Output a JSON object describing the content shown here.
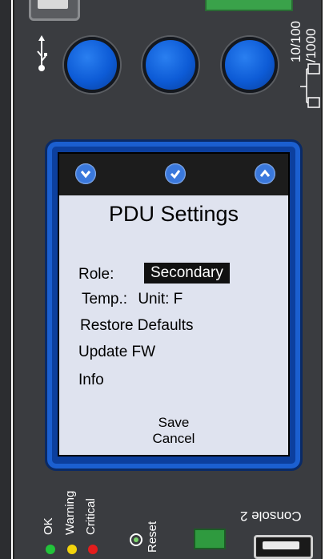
{
  "network": {
    "speed_line1": "10/100",
    "speed_line2": "/1000"
  },
  "screen": {
    "title": "PDU Settings",
    "role_label": "Role:",
    "role_value": "Secondary",
    "temp_label": "Temp.:",
    "temp_value": "Unit: F",
    "restore_label": "Restore Defaults",
    "update_label": "Update FW",
    "info_label": "Info",
    "save_label": "Save",
    "cancel_label": "Cancel"
  },
  "nav_icons": [
    "chevron-down-icon",
    "check-icon",
    "chevron-up-icon"
  ],
  "status": {
    "ok_label": "OK",
    "warning_label": "Warning",
    "critical_label": "Critical"
  },
  "reset_label": "Reset",
  "console_label": "Console 2",
  "colors": {
    "ok": "#22c43a",
    "warning": "#f2d40c",
    "critical": "#e41d1d",
    "accent": "#0d5bd6"
  }
}
